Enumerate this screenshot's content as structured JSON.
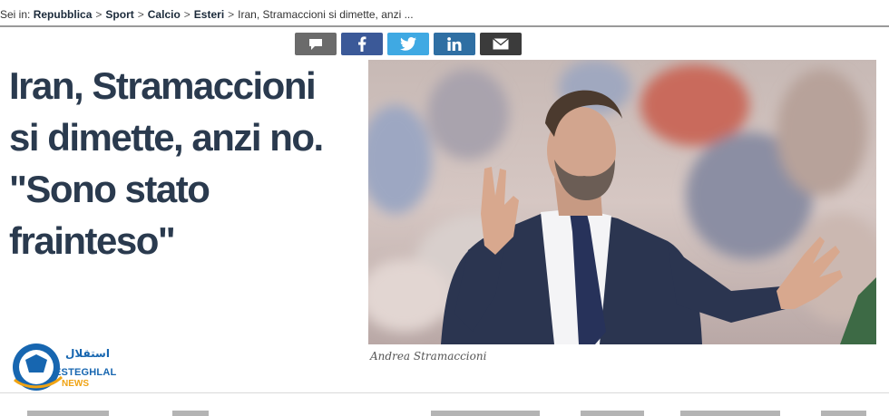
{
  "breadcrumb": {
    "prefix": "Sei in:",
    "items": [
      "Repubblica",
      "Sport",
      "Calcio",
      "Esteri"
    ],
    "current": "Iran, Stramaccioni si dimette, anzi ...",
    "separator": ">"
  },
  "share": {
    "buttons": [
      {
        "icon": "comment-icon",
        "color": "#6b6b6b"
      },
      {
        "icon": "facebook-icon",
        "color": "#3b5998"
      },
      {
        "icon": "twitter-icon",
        "color": "#3fa9e3"
      },
      {
        "icon": "linkedin-icon",
        "color": "#2f6fa3"
      },
      {
        "icon": "mail-icon",
        "color": "#3b3b3b"
      }
    ]
  },
  "article": {
    "headline_lines": [
      "Iran, Stramaccioni",
      "si dimette, anzi no.",
      "\"Sono stato",
      "frainteso\""
    ],
    "photo_caption": "Andrea Stramaccioni"
  },
  "watermark": {
    "fa": "استقلال",
    "name": "ESTEGHLAL",
    "sub": "NEWS"
  },
  "colors": {
    "headline": "#2a3a4e",
    "rule": "#9a9a9a",
    "logo_blue": "#1766b0",
    "logo_orange": "#f0a313"
  }
}
